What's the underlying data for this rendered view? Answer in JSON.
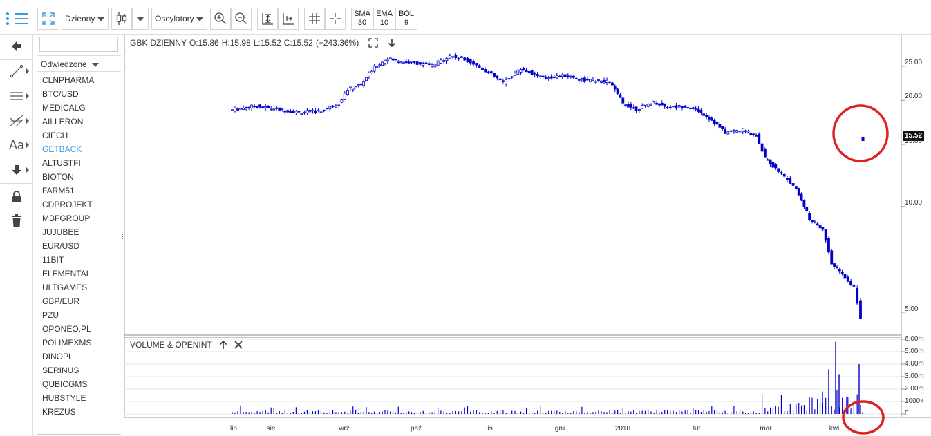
{
  "toolbar": {
    "interval": "Dzienny",
    "oscillators": "Oscylatory",
    "indicators": [
      {
        "name": "SMA",
        "value": "30"
      },
      {
        "name": "EMA",
        "value": "10"
      },
      {
        "name": "BOL",
        "value": "9"
      }
    ],
    "accent_color": "#3b9ae0"
  },
  "watchlist": {
    "search_value": "",
    "mode": "Odwiedzone",
    "active": "GETBACK",
    "items": [
      "CLNPHARMA",
      "BTC/USD",
      "MEDICALG",
      "AILLERON",
      "CIECH",
      "GETBACK",
      "ALTUSTFI",
      "BIOTON",
      "FARM51",
      "CDPROJEKT",
      "MBFGROUP",
      "JUJUBEE",
      "EUR/USD",
      "11BIT",
      "ELEMENTAL",
      "ULTGAMES",
      "GBP/EUR",
      "PZU",
      "OPONEO.PL",
      "POLIMEXMS",
      "DINOPL",
      "SERINUS",
      "QUBICGMS",
      "HUBSTYLE",
      "KREZUS"
    ]
  },
  "chart_header": {
    "symbol": "GBK",
    "interval": "DZIENNY",
    "open": "O:15.86",
    "high": "H:15.98",
    "low": "L:15.52",
    "close": "C:15.52",
    "change": "(+243.36%)"
  },
  "volume_panel": {
    "title": "VOLUME & OPENINT"
  },
  "chart_data": {
    "type": "candlestick",
    "price_scale": "log",
    "price_ticks": [
      "25.00",
      "20.00",
      "15.00",
      "10.00",
      "5.00"
    ],
    "last_price": "15.52",
    "volume_ticks": [
      "6.00m",
      "5.00m",
      "4.00m",
      "3.00m",
      "2.00m",
      "1000k",
      "0"
    ],
    "x_ticks": [
      "lip",
      "sie",
      "wrz",
      "paź",
      "lis",
      "gru",
      "2018",
      "lut",
      "mar",
      "kwi"
    ],
    "candle_color": "#0000cc",
    "highlight_color": "#e02020",
    "series": [
      {
        "m": 6.5,
        "c": 18.8
      },
      {
        "m": 7.0,
        "c": 19.3
      },
      {
        "m": 7.5,
        "c": 18.9
      },
      {
        "m": 8.0,
        "c": 18.5
      },
      {
        "m": 8.5,
        "c": 18.7
      },
      {
        "m": 8.9,
        "c": 19.6
      },
      {
        "m": 9.1,
        "c": 21.5
      },
      {
        "m": 9.4,
        "c": 22.2
      },
      {
        "m": 9.7,
        "c": 24.8
      },
      {
        "m": 10.0,
        "c": 26.3
      },
      {
        "m": 10.3,
        "c": 25.8
      },
      {
        "m": 10.6,
        "c": 25.6
      },
      {
        "m": 11.0,
        "c": 25.1
      },
      {
        "m": 11.4,
        "c": 26.8
      },
      {
        "m": 11.8,
        "c": 26.0
      },
      {
        "m": 12.2,
        "c": 24.3
      },
      {
        "m": 12.6,
        "c": 22.5
      },
      {
        "m": 13.0,
        "c": 24.6
      },
      {
        "m": 13.5,
        "c": 23.2
      },
      {
        "m": 14.0,
        "c": 23.5
      },
      {
        "m": 14.5,
        "c": 22.8
      },
      {
        "m": 15.0,
        "c": 22.6
      },
      {
        "m": 15.3,
        "c": 19.6
      },
      {
        "m": 15.6,
        "c": 18.9
      },
      {
        "m": 16.0,
        "c": 19.8
      },
      {
        "m": 16.3,
        "c": 19.1
      },
      {
        "m": 16.7,
        "c": 19.3
      },
      {
        "m": 17.0,
        "c": 18.7
      },
      {
        "m": 17.3,
        "c": 17.6
      },
      {
        "m": 17.6,
        "c": 16.2
      },
      {
        "m": 18.0,
        "c": 16.5
      },
      {
        "m": 18.3,
        "c": 15.9
      },
      {
        "m": 18.5,
        "c": 13.7
      },
      {
        "m": 18.8,
        "c": 12.6
      },
      {
        "m": 19.2,
        "c": 11.2
      },
      {
        "m": 19.5,
        "c": 9.2
      },
      {
        "m": 19.8,
        "c": 8.6
      },
      {
        "m": 20.0,
        "c": 6.9
      },
      {
        "m": 20.3,
        "c": 6.3
      },
      {
        "m": 20.5,
        "c": 5.9
      },
      {
        "m": 20.65,
        "c": 4.8
      },
      {
        "m": 20.75,
        "c": 15.52
      }
    ]
  }
}
